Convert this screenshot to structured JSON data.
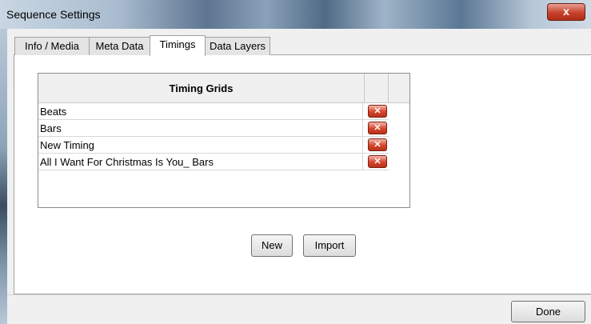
{
  "window": {
    "title": "Sequence Settings",
    "close_label": "x"
  },
  "tabs": [
    {
      "label": "Info / Media"
    },
    {
      "label": "Meta Data"
    },
    {
      "label": "Timings"
    },
    {
      "label": "Data Layers"
    }
  ],
  "active_tab": "Timings",
  "timing_grid": {
    "header": "Timing Grids",
    "rows": [
      {
        "name": "Beats",
        "delete_icon": "delete-x-icon"
      },
      {
        "name": "Bars",
        "delete_icon": "delete-x-icon"
      },
      {
        "name": "New Timing",
        "delete_icon": "delete-x-icon"
      },
      {
        "name": "All I Want For Christmas Is You_ Bars",
        "delete_icon": "delete-x-icon"
      }
    ],
    "delete_symbol": "✕"
  },
  "buttons": {
    "new_label": "New",
    "import_label": "Import",
    "done_label": "Done"
  },
  "colors": {
    "delete_button": "#d6452c",
    "close_button": "#c7412b"
  }
}
